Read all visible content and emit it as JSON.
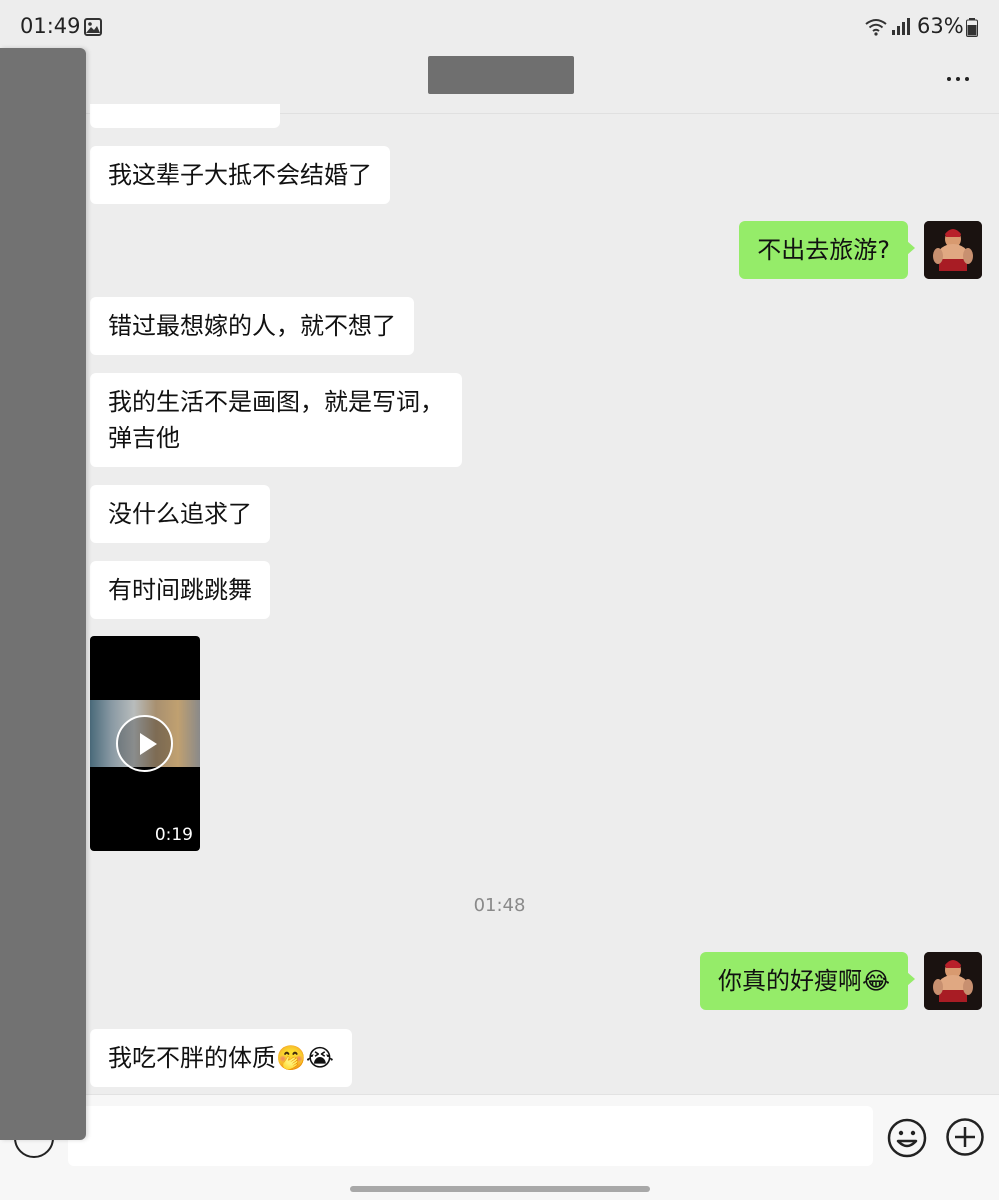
{
  "status_bar": {
    "time": "01:49",
    "battery": "63%",
    "icons": [
      "gallery-icon",
      "wifi-icon",
      "signal-icon",
      "battery-icon"
    ]
  },
  "header": {
    "more_icon": "more-icon"
  },
  "messages": [
    {
      "side": "in",
      "text": "我这辈子大抵不会结婚了"
    },
    {
      "side": "out",
      "text": "不出去旅游?"
    },
    {
      "side": "in",
      "text": "错过最想嫁的人，就不想了"
    },
    {
      "side": "in",
      "text_line1": "我的生活不是画图，就是写词，",
      "text_line2": "弹吉他"
    },
    {
      "side": "in",
      "text": "没什么追求了"
    },
    {
      "side": "in",
      "text": "有时间跳跳舞"
    },
    {
      "side": "in",
      "type": "video",
      "duration": "0:19"
    },
    {
      "side": "out",
      "text": "你真的好瘦啊😂"
    },
    {
      "side": "in",
      "text": "我吃不胖的体质🤭😭"
    }
  ],
  "timestamp": "01:48",
  "input_bar": {
    "placeholder": "",
    "icons": [
      "voice-icon",
      "emoji-icon",
      "plus-icon"
    ]
  },
  "colors": {
    "background": "#ededed",
    "incoming_bubble": "#ffffff",
    "outgoing_bubble": "#95ec69"
  }
}
